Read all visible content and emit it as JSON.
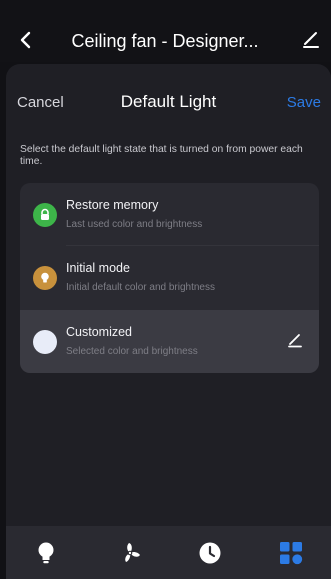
{
  "topbar": {
    "title": "Ceiling fan - Designer...",
    "back_icon": "back-arrow-icon",
    "edit_icon": "edit-pencil-icon"
  },
  "sheet": {
    "cancel_label": "Cancel",
    "title": "Default Light",
    "save_label": "Save",
    "description": "Select the default light state that is turned on from power each time."
  },
  "options": [
    {
      "title": "Restore memory",
      "subtitle": "Last used color and brightness",
      "icon": "lock-icon",
      "icon_color": "#3db549",
      "selected": false
    },
    {
      "title": "Initial mode",
      "subtitle": "Initial default color and brightness",
      "icon": "bulb-icon",
      "icon_color": "#c8913c",
      "selected": false
    },
    {
      "title": "Customized",
      "subtitle": "Selected color and brightness",
      "icon": "color-swatch-icon",
      "icon_color": "#e8ecf8",
      "selected": true
    }
  ],
  "bottom_nav": {
    "items": [
      {
        "icon": "light-bulb-icon",
        "active": false
      },
      {
        "icon": "fan-icon",
        "active": false
      },
      {
        "icon": "clock-icon",
        "active": false
      },
      {
        "icon": "grid-icon",
        "active": true
      }
    ]
  },
  "colors": {
    "accent": "#2c7be5",
    "background": "#111115",
    "sheet": "#1f1f25",
    "card": "#2a2a31",
    "selected_row": "#3b3b43"
  }
}
